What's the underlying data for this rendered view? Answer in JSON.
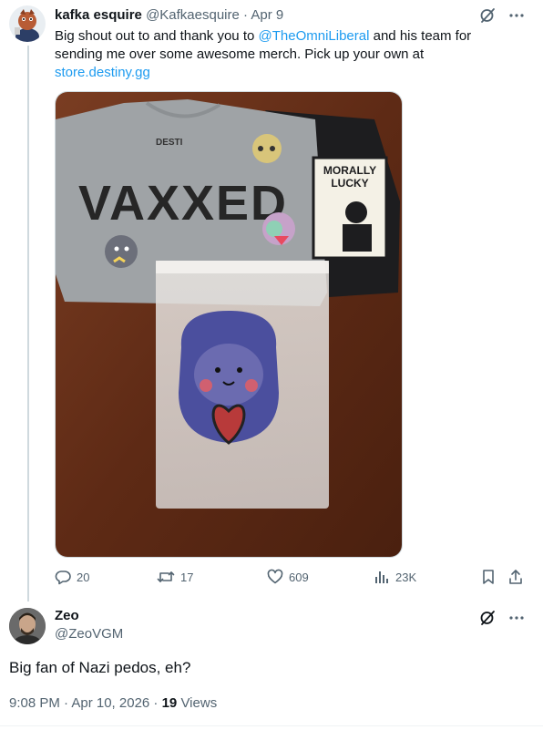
{
  "tweet": {
    "author_name": "kafka esquire",
    "author_handle": "@Kafkaesquire",
    "separator": "·",
    "date": "Apr 9",
    "text_part1": "Big shout out to and thank you to ",
    "mention": "@TheOmniLiberal",
    "text_part2": " and his team for sending me over some awesome merch. Pick up your own at ",
    "link": "store.destiny.gg",
    "image": {
      "shirt_text": "VAXXED",
      "black_shirt_text_line1": "MORALLY",
      "black_shirt_text_line2": "LUCKY",
      "brand_text": "DESTI"
    },
    "stats": {
      "replies": "20",
      "reposts": "17",
      "likes": "609",
      "views": "23K"
    }
  },
  "reply": {
    "author_name": "Zeo",
    "author_handle": "@ZeoVGM",
    "text": "Big fan of Nazi pedos, eh?",
    "timestamp": "9:08 PM · Apr 10, 2026 · ",
    "views_count": "19",
    "views_label": " Views"
  },
  "colors": {
    "link": "#1d9bf0",
    "secondary": "#536471",
    "primary_text": "#0f1419",
    "divider": "#cfd9de"
  }
}
